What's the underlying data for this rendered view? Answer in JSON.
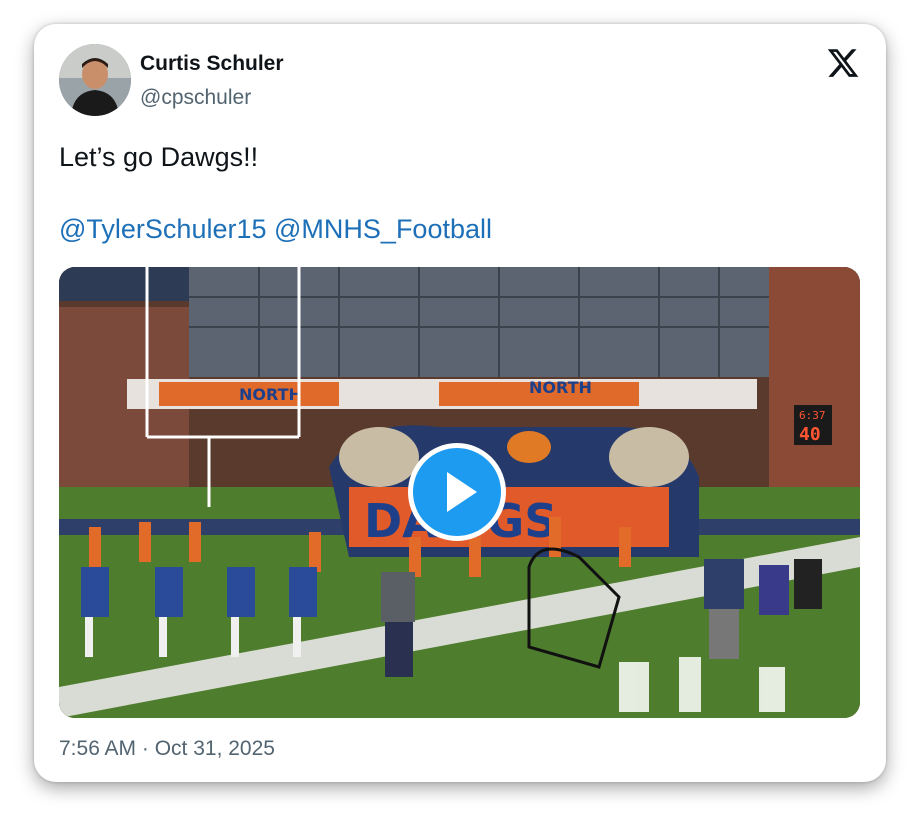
{
  "author": {
    "name": "Curtis Schuler",
    "handle": "@cpschuler"
  },
  "tweet": {
    "text": "Let’s go Dawgs!!",
    "mentions": [
      "@TylerSchuler15",
      "@MNHS_Football"
    ]
  },
  "media": {
    "type": "video",
    "scene_texts": {
      "banner_left": "NORTH",
      "banner_right": "NORTH",
      "tunnel_text": "DAWGS",
      "scoreboard_clock": "6:37",
      "scoreboard_score": "40"
    }
  },
  "meta": {
    "timestamp": "7:56 AM · Oct 31, 2025"
  },
  "icons": {
    "brand": "x-logo-icon",
    "play": "play-icon"
  },
  "colors": {
    "link": "#1d70b8",
    "play_button": "#1d9bf0",
    "text": "#0f1419",
    "secondary": "#536471"
  }
}
